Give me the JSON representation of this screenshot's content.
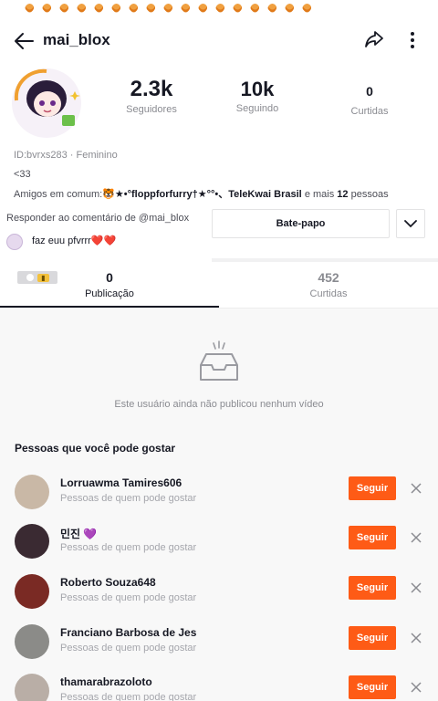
{
  "header": {
    "username": "mai_blox"
  },
  "stats": {
    "followers": {
      "value": "2.3k",
      "label": "Seguidores"
    },
    "following": {
      "value": "10k",
      "label": "Seguindo"
    },
    "likes": {
      "value": "0",
      "label": "Curtidas"
    }
  },
  "profile": {
    "id_line": "ID:bvrxs283",
    "gender": "Feminino",
    "bio": "<33",
    "mutual_prefix": "Amigos em comum:",
    "mutual_names": "🐯★•°floppforfurry†★°°•、TeleKwai Brasil",
    "mutual_suffix_text": "e mais",
    "mutual_count": "12",
    "mutual_suffix_end": "pessoas"
  },
  "reply": {
    "prompt": "Responder ao comentário de @mai_blox",
    "comment": "faz euu pfvrrr",
    "hearts": "❤️❤️"
  },
  "actions": {
    "chat_label": "Bate-papo"
  },
  "tabs": [
    {
      "count": "0",
      "label": "Publicação",
      "active": true
    },
    {
      "count": "452",
      "label": "Curtidas",
      "active": false
    }
  ],
  "empty_state": {
    "text": "Este usuário ainda não publicou nenhum vídeo"
  },
  "suggestions": {
    "title": "Pessoas que você pode gostar",
    "follow_label": "Seguir",
    "items": [
      {
        "name": "Lorruawma Tamires606",
        "subtitle": "Pessoas de quem pode gostar",
        "avatar_color": "#c9b8a6"
      },
      {
        "name": "민진 💜",
        "subtitle": "Pessoas de quem pode gostar",
        "avatar_color": "#3a2a32"
      },
      {
        "name": "Roberto Souza648",
        "subtitle": "Pessoas de quem pode gostar",
        "avatar_color": "#7a2a24"
      },
      {
        "name": "Franciano Barbosa de Jes",
        "subtitle": "Pessoas de quem pode gostar",
        "avatar_color": "#8b8b88"
      },
      {
        "name": "thamarabrazoloto",
        "subtitle": "Pessoas de quem pode gostar",
        "avatar_color": "#b9aea6"
      }
    ]
  },
  "colors": {
    "accent": "#fe5b16",
    "text_primary": "#161823",
    "text_secondary": "#8a8b91"
  }
}
